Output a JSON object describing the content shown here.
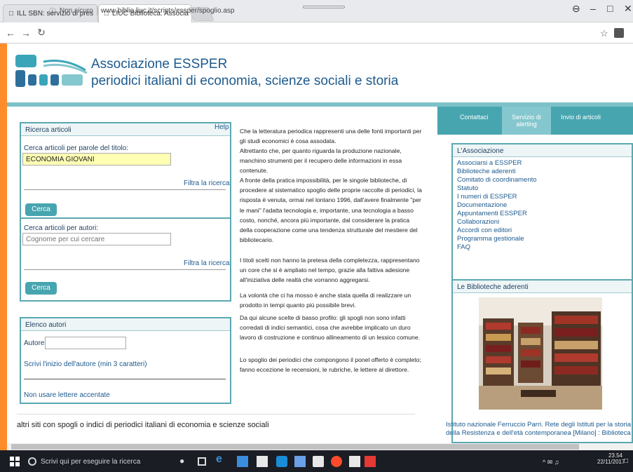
{
  "browser": {
    "tabs": [
      {
        "title": "ILL SBN: servizio di pres"
      },
      {
        "title": "LIUC Biblioteca. Associa"
      }
    ],
    "security": "Non sicuro",
    "url": "www.biblio.liuc.it/scripts/essper/spoglio.asp",
    "controls": {
      "user": "⊖",
      "min": "–",
      "max": "□",
      "close": "✕"
    }
  },
  "site": {
    "title": "Associazione ESSPER",
    "subtitle": "periodici italiani di economia, scienze sociali e storia"
  },
  "search_articles": {
    "header": "Ricerca articoli",
    "help": "Help",
    "title_label": "Cerca articoli per parole del titolo:",
    "title_value": "ECONOMIA GIOVANI",
    "refine": "Filtra la ricerca",
    "search_btn": "Cerca",
    "author_label": "Cerca articoli per autori:",
    "author_placeholder": "Cognome per cui cercare",
    "refine2": "Filtra la ricerca",
    "search_btn2": "Cerca"
  },
  "authors_list": {
    "header": "Elenco autori",
    "author_label": "Autore:",
    "hint": "Scrivi l'inizio dell'autore (min 3 caratteri)",
    "note": "Non usare lettere accentate"
  },
  "intro": {
    "p1": "Che la letteratura periodica rappresenti una delle fonti importanti per gli studi economici è cosa assodata.",
    "p2": "Altrettanto che, per quanto riguarda la produzione nazionale, manchino strumenti per il recupero delle informazioni in essa contenute.",
    "p3": "A fronte della pratica impossibilità, per le singole biblioteche, di procedere al sistematico spoglio delle proprie raccolte di periodici, la risposta è venuta, ormai nel lontano 1996, dall'avere finalmente \"per le mani\" l'adatta tecnologia e, importante, una tecnologia a basso costo, nonché, ancora più importante, dal considerare la pratica della cooperazione come una tendenza strutturale del mestiere del bibliotecario.",
    "p4": "I titoli scelti non hanno la pretesa della completezza, rappresentano un core che si è ampliato nel tempo, grazie alla fattiva adesione all'iniziativa delle realtà che vorranno aggregarsi.",
    "p5": "La volontà che ci ha mosso è anche stata quella di realizzare un prodotto in tempi quanto più possibile brevi.",
    "p6": "Da qui alcune scelte di basso profilo: gli spogli non sono infatti corredati di indici semantici, cosa che avrebbe implicato un duro lavoro di costruzione e continuo allineamento di un lessico comune.",
    "p7": "Lo spoglio dei periodici che compongono il ponel offerto è completo; fanno eccezione le recensioni, le rubriche, le lettere al direttore."
  },
  "other_sites": "altri siti con spogli o indici di periodici italiani di economia e scienze sociali",
  "right_tabs": [
    "Contattaci",
    "Servizio di alerting",
    "Invio di articoli"
  ],
  "association": {
    "header": "L'Associazione",
    "items": [
      "Associarsi a ESSPER",
      "Biblioteche aderenti",
      "Comitato di coordinamento",
      "Statuto",
      "I numeri di ESSPER",
      "Documentazione",
      "Appuntamenti ESSPER",
      "Collaborazioni",
      "Accordi con editori",
      "Programma gestionale",
      "FAQ"
    ]
  },
  "libraries": {
    "header": "Le Biblioteche aderenti",
    "caption": "Istituto nazionale Ferruccio Parri. Rete degli Istituti per la storia della Resistenza e dell'età contemporanea [Milano] : Biblioteca"
  },
  "taskbar": {
    "search": "Scrivi qui per eseguire la ricerca",
    "time": "23.54",
    "date": "22/11/2017"
  }
}
